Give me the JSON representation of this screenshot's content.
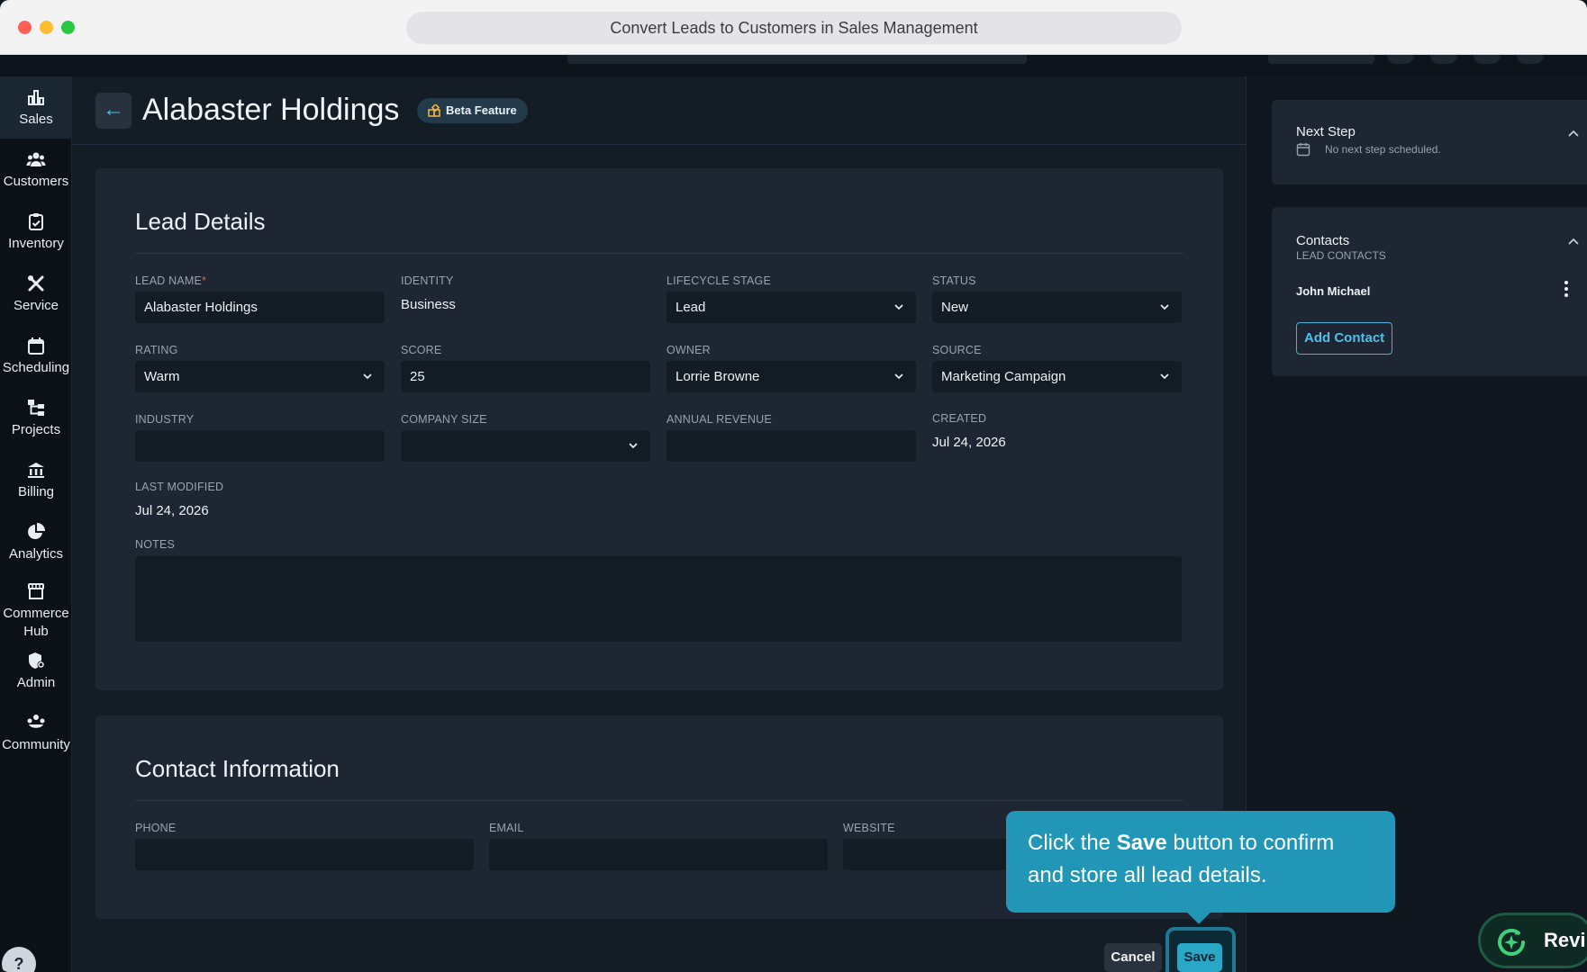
{
  "browser": {
    "title": "Convert Leads to Customers in Sales Management"
  },
  "sidebar": {
    "items": [
      {
        "label": "Sales",
        "icon": "bar-chart-icon",
        "active": true
      },
      {
        "label": "Customers",
        "icon": "users-icon"
      },
      {
        "label": "Inventory",
        "icon": "clipboard-icon"
      },
      {
        "label": "Service",
        "icon": "tools-icon"
      },
      {
        "label": "Scheduling",
        "icon": "calendar-icon"
      },
      {
        "label": "Projects",
        "icon": "hierarchy-icon"
      },
      {
        "label": "Billing",
        "icon": "bank-icon"
      },
      {
        "label": "Analytics",
        "icon": "pie-chart-icon"
      },
      {
        "label": "Commerce Hub",
        "label_line1": "Commerce",
        "label_line2": "Hub",
        "icon": "storefront-icon"
      },
      {
        "label": "Admin",
        "icon": "admin-shield-icon"
      },
      {
        "label": "Community",
        "icon": "community-icon"
      }
    ],
    "help": "?"
  },
  "header": {
    "title": "Alabaster Holdings",
    "badge": "Beta Feature"
  },
  "lead_details": {
    "title": "Lead Details",
    "lead_name": {
      "label": "LEAD NAME",
      "required_mark": "*",
      "value": "Alabaster Holdings"
    },
    "identity": {
      "label": "IDENTITY",
      "value": "Business"
    },
    "lifecycle_stage": {
      "label": "LIFECYCLE STAGE",
      "value": "Lead"
    },
    "status": {
      "label": "STATUS",
      "value": "New"
    },
    "rating": {
      "label": "RATING",
      "value": "Warm"
    },
    "score": {
      "label": "SCORE",
      "value": "25"
    },
    "owner": {
      "label": "OWNER",
      "value": "Lorrie Browne"
    },
    "source": {
      "label": "SOURCE",
      "value": "Marketing Campaign"
    },
    "industry": {
      "label": "INDUSTRY",
      "value": ""
    },
    "company_size": {
      "label": "COMPANY SIZE",
      "value": ""
    },
    "annual_revenue": {
      "label": "ANNUAL REVENUE",
      "value": ""
    },
    "created": {
      "label": "CREATED",
      "value": "Jul 24, 2026"
    },
    "last_modified": {
      "label": "LAST MODIFIED",
      "value": "Jul 24, 2026"
    },
    "notes": {
      "label": "NOTES",
      "value": ""
    }
  },
  "contact_information": {
    "title": "Contact Information",
    "phone": {
      "label": "PHONE",
      "value": ""
    },
    "email": {
      "label": "EMAIL",
      "value": ""
    },
    "website": {
      "label": "WEBSITE",
      "value": ""
    }
  },
  "right_panel": {
    "next_step": {
      "title": "Next Step",
      "text": "No next step scheduled."
    },
    "contacts": {
      "title": "Contacts",
      "subtitle": "LEAD CONTACTS",
      "items": [
        {
          "name": "John Michael"
        }
      ],
      "add_button": "Add Contact"
    }
  },
  "tooltip": {
    "prefix": "Click the ",
    "bold": "Save",
    "suffix": " button to confirm and store all lead details."
  },
  "actions": {
    "cancel": "Cancel",
    "save": "Save"
  },
  "review_widget": {
    "label": "Revi"
  },
  "colors": {
    "accent": "#2aa6c7",
    "tooltip": "#2196b7",
    "background": "#141c25",
    "card": "#1d2632"
  }
}
